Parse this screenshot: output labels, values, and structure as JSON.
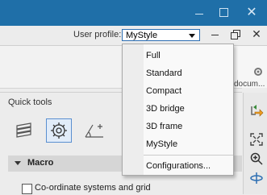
{
  "window": {
    "minimize_icon": "minimize-icon",
    "maximize_icon": "maximize-icon",
    "close_icon": "close-icon",
    "close_glyph": "✕",
    "title_bar_color": "#1f6fa8"
  },
  "profile_bar": {
    "label": "User profile:",
    "selected": "MyStyle"
  },
  "profile_dropdown": {
    "items": [
      "Full",
      "Standard",
      "Compact",
      "3D bridge",
      "3D frame",
      "MyStyle"
    ],
    "footer_item": "Configurations..."
  },
  "ribbon": {
    "truncated_text": "docum..."
  },
  "quick_tools": {
    "title": "Quick tools",
    "icons": [
      "layers-icon",
      "gear-icon",
      "angle-plus-icon"
    ],
    "macro_section": {
      "title": "Macro",
      "items": [
        {
          "label": "Co-ordinate systems and grid",
          "checked": false
        }
      ]
    }
  },
  "right_toolbar": {
    "icons": [
      "import-arrow-icon",
      "fit-view-icon",
      "zoom-in-icon",
      "orbit-icon"
    ]
  },
  "colors": {
    "accent": "#2d6fb3",
    "selected_icon_border": "#5a8fd0"
  }
}
